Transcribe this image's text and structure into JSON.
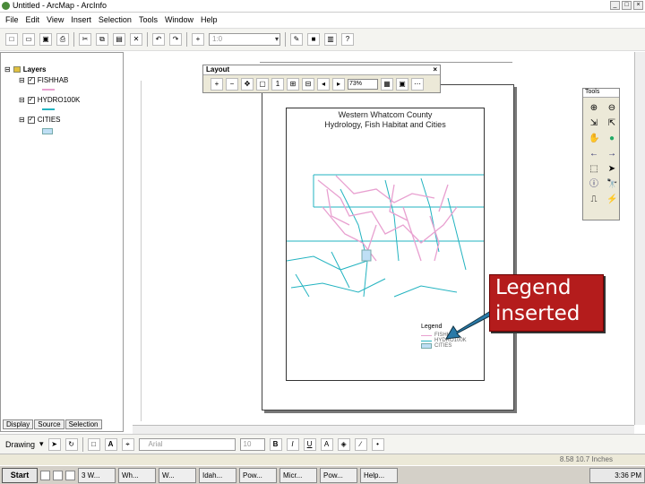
{
  "window": {
    "title": "Untitled - ArcMap - ArcInfo"
  },
  "menu": [
    "File",
    "Edit",
    "View",
    "Insert",
    "Selection",
    "Tools",
    "Window",
    "Help"
  ],
  "toc": {
    "root": "Layers",
    "layers": [
      {
        "name": "FISHHAB",
        "color": "#e8a0d0"
      },
      {
        "name": "HYDRO100K",
        "color": "#22b3c0"
      },
      {
        "name": "CITIES",
        "color": "#bfdff5"
      }
    ],
    "tabs": [
      "Display",
      "Source",
      "Selection"
    ]
  },
  "layout_toolbar": {
    "title": "Layout",
    "zoom": "73%"
  },
  "tools_toolbar": {
    "title": "Tools"
  },
  "map": {
    "title_line1": "Western Whatcom County",
    "title_line2": "Hydrology, Fish Habitat and Cities",
    "legend": {
      "title": "Legend",
      "items": [
        "FISHHAB",
        "HYDRO100K",
        "CITIES"
      ]
    }
  },
  "callout": {
    "line1": "Legend",
    "line2": "inserted"
  },
  "drawing": {
    "label": "Drawing",
    "font": "Arial",
    "size": "10"
  },
  "status": {
    "coords": "8.58 10.7 Inches"
  },
  "taskbar": {
    "start": "Start",
    "tasks": [
      "3 W...",
      "Wh...",
      "W...",
      "Idah...",
      "Pow...",
      "Micr...",
      "Pow...",
      "Help..."
    ],
    "clock": "3:36 PM"
  },
  "colors": {
    "fish": "#e8a0d0",
    "hydro": "#22b3c0",
    "cities": "#bfdff5",
    "callout": "#b41c1c"
  }
}
